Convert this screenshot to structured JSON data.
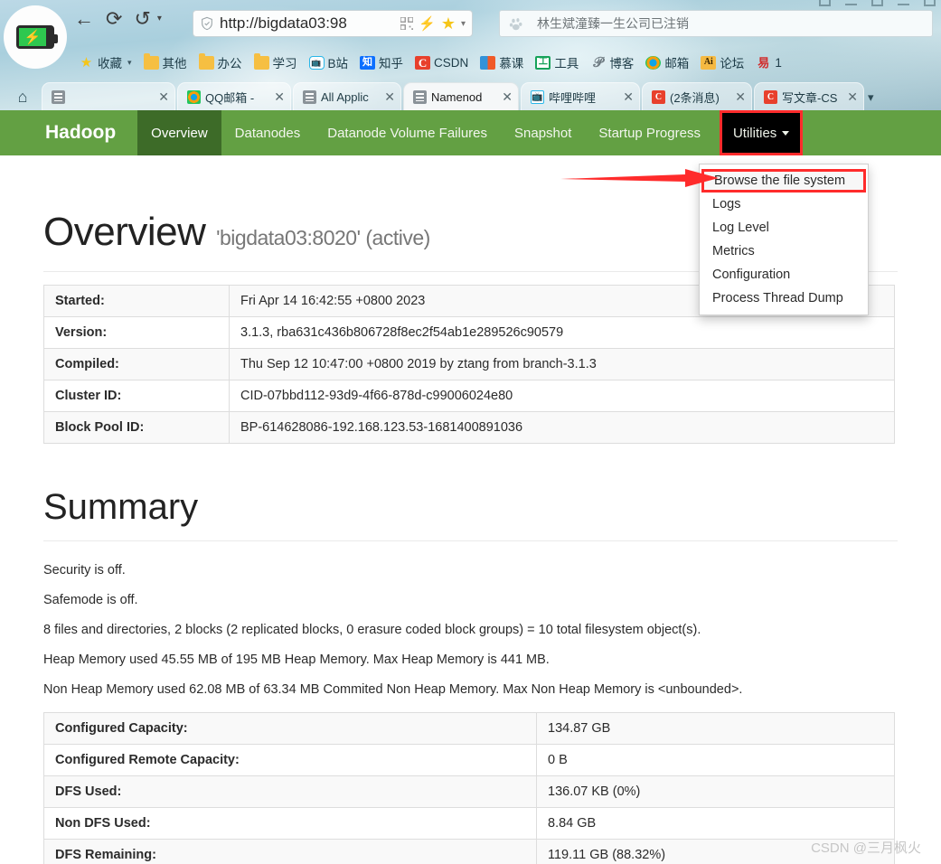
{
  "browser": {
    "url": "http://bigdata03:98",
    "search_placeholder": "林生斌潼臻一生公司已注销",
    "nav_icons": {
      "back": "back-arrow-icon",
      "reload": "reload-icon",
      "history": "history-back-icon"
    },
    "bookmarks": [
      {
        "label": "收藏",
        "icon": "star-icon",
        "caret": "▾"
      },
      {
        "label": "其他",
        "icon": "folder-icon"
      },
      {
        "label": "办公",
        "icon": "folder-icon"
      },
      {
        "label": "学习",
        "icon": "folder-icon"
      },
      {
        "label": "B站",
        "icon": "bilibili-icon"
      },
      {
        "label": "知乎",
        "icon": "zhihu-icon"
      },
      {
        "label": "CSDN",
        "icon": "csdn-icon"
      },
      {
        "label": "慕课",
        "icon": "imooc-icon"
      },
      {
        "label": "工具",
        "icon": "tools-icon"
      },
      {
        "label": "博客",
        "icon": "blog-icon"
      },
      {
        "label": "邮箱",
        "icon": "mail-icon"
      },
      {
        "label": "论坛",
        "icon": "adobe-ai-icon"
      },
      {
        "label": "1",
        "icon": "red-seal-icon"
      }
    ],
    "tabs": [
      {
        "label": "",
        "favicon": "doc-icon",
        "active": false
      },
      {
        "label": "QQ邮箱 -",
        "favicon": "qq-mail-icon",
        "active": false
      },
      {
        "label": "All Applic",
        "favicon": "doc-icon",
        "active": false
      },
      {
        "label": "Namenod",
        "favicon": "doc-icon",
        "active": true
      },
      {
        "label": "哔哩哔哩",
        "favicon": "bilibili-icon",
        "active": false
      },
      {
        "label": "(2条消息)",
        "favicon": "csdn-icon",
        "active": false
      },
      {
        "label": "写文章-CS",
        "favicon": "csdn-icon",
        "active": false
      }
    ],
    "tab_close_label": "✕",
    "home_label": "⌂",
    "tab_overflow_label": "▾"
  },
  "navbar": {
    "brand": "Hadoop",
    "items": [
      {
        "label": "Overview",
        "active": true
      },
      {
        "label": "Datanodes",
        "active": false
      },
      {
        "label": "Datanode Volume Failures",
        "active": false
      },
      {
        "label": "Snapshot",
        "active": false
      },
      {
        "label": "Startup Progress",
        "active": false
      }
    ],
    "utilities_label": "Utilities",
    "accent_green": "#63a043",
    "active_green": "#3d6b28",
    "highlight_red": "#ff2b2b"
  },
  "dropdown": {
    "items": [
      {
        "label": "Browse the file system",
        "highlighted": true
      },
      {
        "label": "Logs",
        "highlighted": false
      },
      {
        "label": "Log Level",
        "highlighted": false
      },
      {
        "label": "Metrics",
        "highlighted": false
      },
      {
        "label": "Configuration",
        "highlighted": false
      },
      {
        "label": "Process Thread Dump",
        "highlighted": false
      }
    ]
  },
  "overview": {
    "title": "Overview",
    "subtitle": "'bigdata03:8020' (active)",
    "rows": [
      {
        "key": "Started:",
        "value": "Fri Apr 14 16:42:55 +0800 2023"
      },
      {
        "key": "Version:",
        "value": "3.1.3, rba631c436b806728f8ec2f54ab1e289526c90579"
      },
      {
        "key": "Compiled:",
        "value": "Thu Sep 12 10:47:00 +0800 2019 by ztang from branch-3.1.3"
      },
      {
        "key": "Cluster ID:",
        "value": "CID-07bbd112-93d9-4f66-878d-c99006024e80"
      },
      {
        "key": "Block Pool ID:",
        "value": "BP-614628086-192.168.123.53-1681400891036"
      }
    ]
  },
  "summary": {
    "title": "Summary",
    "lines": [
      "Security is off.",
      "Safemode is off.",
      "8 files and directories, 2 blocks (2 replicated blocks, 0 erasure coded block groups) = 10 total filesystem object(s).",
      "Heap Memory used 45.55 MB of 195 MB Heap Memory. Max Heap Memory is 441 MB.",
      "Non Heap Memory used 62.08 MB of 63.34 MB Commited Non Heap Memory. Max Non Heap Memory is <unbounded>."
    ],
    "capacity_rows": [
      {
        "key": "Configured Capacity:",
        "value": "134.87 GB"
      },
      {
        "key": "Configured Remote Capacity:",
        "value": "0 B"
      },
      {
        "key": "DFS Used:",
        "value": "136.07 KB (0%)"
      },
      {
        "key": "Non DFS Used:",
        "value": "8.84 GB"
      },
      {
        "key": "DFS Remaining:",
        "value": "119.11 GB (88.32%)"
      }
    ]
  },
  "watermark": "CSDN @三月枫火"
}
